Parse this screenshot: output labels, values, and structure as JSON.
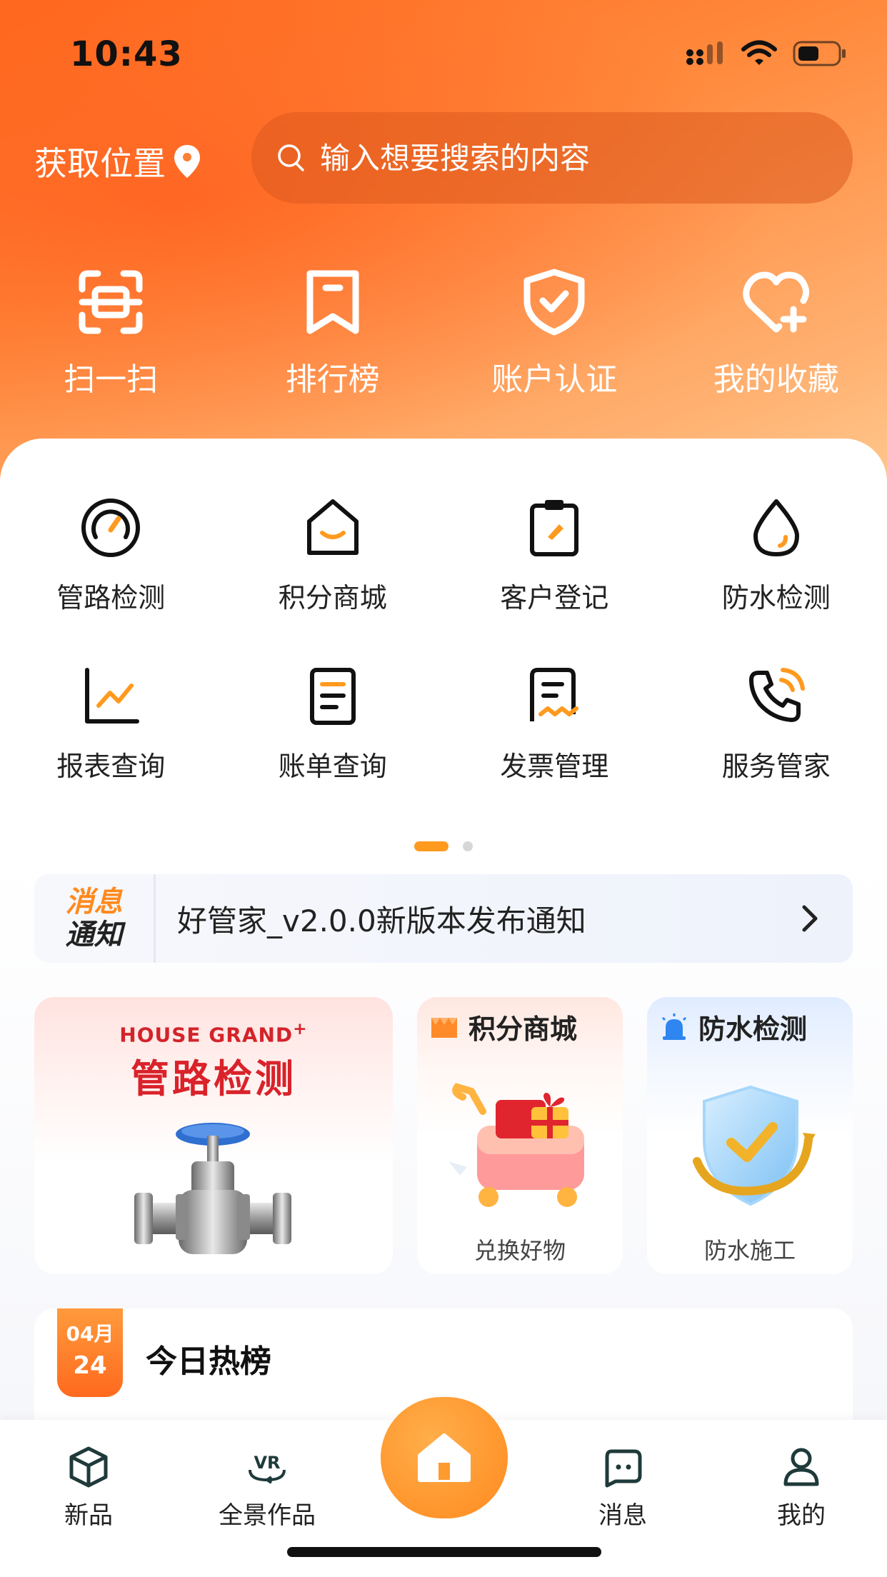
{
  "status": {
    "time": "10:43"
  },
  "top": {
    "location_label": "获取位置",
    "search_placeholder": "输入想要搜索的内容"
  },
  "quick_actions": [
    {
      "label": "扫一扫",
      "icon": "scan-icon"
    },
    {
      "label": "排行榜",
      "icon": "bookmark-icon"
    },
    {
      "label": "账户认证",
      "icon": "shield-check-icon"
    },
    {
      "label": "我的收藏",
      "icon": "heart-plus-icon"
    }
  ],
  "grid": [
    {
      "label": "管路检测",
      "icon": "gauge-icon"
    },
    {
      "label": "积分商城",
      "icon": "shop-house-icon"
    },
    {
      "label": "客户登记",
      "icon": "clipboard-edit-icon"
    },
    {
      "label": "防水检测",
      "icon": "water-drop-icon"
    },
    {
      "label": "报表查询",
      "icon": "line-chart-icon"
    },
    {
      "label": "账单查询",
      "icon": "document-icon"
    },
    {
      "label": "发票管理",
      "icon": "receipt-icon"
    },
    {
      "label": "服务管家",
      "icon": "phone-call-icon"
    }
  ],
  "notice": {
    "tag_line1": "消息",
    "tag_line2": "通知",
    "text": "好管家_v2.0.0新版本发布通知"
  },
  "promos": {
    "pipe": {
      "brand": "HOUSE GRAND",
      "brand_sup": "+",
      "title": "管路检测"
    },
    "points": {
      "title": "积分商城",
      "caption": "兑换好物"
    },
    "waterproof": {
      "title": "防水检测",
      "caption": "防水施工"
    }
  },
  "hot": {
    "month": "04月",
    "day": "24",
    "title": "今日热榜"
  },
  "tabs": {
    "new": "新品",
    "vr": "全景作品",
    "vr_badge": "VR",
    "message": "消息",
    "mine": "我的"
  },
  "colors": {
    "accent": "#ff8a1e",
    "brand_red": "#d9222a"
  }
}
